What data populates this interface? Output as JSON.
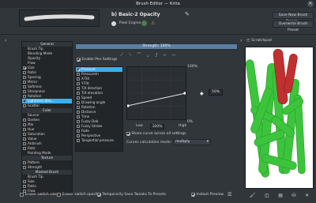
{
  "window": {
    "title": "Brush Editor — Krita"
  },
  "header": {
    "preset_name": "b) Basic-2 Opacity",
    "engine_label": "Pixel Engine",
    "save_new_label": "Save New Brush Preset...",
    "overwrite_label": "Overwrite Brush Preset"
  },
  "sidebar": {
    "items": [
      {
        "label": "General",
        "type": "header"
      },
      {
        "label": "Brush Tip",
        "checkbox": false
      },
      {
        "label": "Blending Mode",
        "checkbox": false
      },
      {
        "label": "Opacity",
        "checkbox": false
      },
      {
        "label": "Flow",
        "checkbox": false
      },
      {
        "label": "Size",
        "checkbox": true,
        "checked": true
      },
      {
        "label": "Ratio",
        "checkbox": true,
        "checked": false
      },
      {
        "label": "Spacing",
        "checkbox": true,
        "checked": false
      },
      {
        "label": "Mirror",
        "checkbox": true,
        "checked": false
      },
      {
        "label": "Softness",
        "checkbox": true,
        "checked": false
      },
      {
        "label": "Sharpness",
        "checkbox": true,
        "checked": false
      },
      {
        "label": "Rotation",
        "checkbox": true,
        "checked": false
      },
      {
        "label": "Lightness Stre...",
        "checkbox": true,
        "checked": false,
        "selected": true
      },
      {
        "label": "Scatter",
        "checkbox": true,
        "checked": false
      },
      {
        "label": "Color",
        "type": "header"
      },
      {
        "label": "Source",
        "checkbox": false
      },
      {
        "label": "Darken",
        "checkbox": true,
        "checked": false
      },
      {
        "label": "Mix",
        "checkbox": true,
        "checked": false
      },
      {
        "label": "Hue",
        "checkbox": true,
        "checked": false
      },
      {
        "label": "Saturation",
        "checkbox": true,
        "checked": false
      },
      {
        "label": "Value",
        "checkbox": true,
        "checked": false
      },
      {
        "label": "Airbrush",
        "checkbox": true,
        "checked": false
      },
      {
        "label": "Rate",
        "checkbox": true,
        "checked": false
      },
      {
        "label": "Painting Mode",
        "checkbox": false
      },
      {
        "label": "Texture",
        "type": "header"
      },
      {
        "label": "Pattern",
        "checkbox": true,
        "checked": false
      },
      {
        "label": "Strength",
        "checkbox": true,
        "checked": false
      },
      {
        "label": "Masked Brush",
        "type": "header"
      },
      {
        "label": "Brush Tip",
        "checkbox": false
      },
      {
        "label": "Size",
        "checkbox": true,
        "checked": false
      },
      {
        "label": "Ratio",
        "checkbox": true,
        "checked": false
      },
      {
        "label": "Flow",
        "checkbox": true,
        "checked": false
      }
    ]
  },
  "settings": {
    "strength_label": "Strength: 100%",
    "enable_pen_label": "Enable Pen Settings",
    "sensors": [
      {
        "label": "Pressure",
        "checked": true,
        "selected": true
      },
      {
        "label": "PressureIn",
        "checked": false
      },
      {
        "label": "X-Tilt",
        "checked": false
      },
      {
        "label": "Y-Tilt",
        "checked": false
      },
      {
        "label": "Tilt direction",
        "checked": false
      },
      {
        "label": "Tilt elevation",
        "checked": false
      },
      {
        "label": "Speed",
        "checked": false
      },
      {
        "label": "Drawing angle",
        "checked": false
      },
      {
        "label": "Rotation",
        "checked": false
      },
      {
        "label": "Distance",
        "checked": false
      },
      {
        "label": "Time",
        "checked": false
      },
      {
        "label": "Fuzzy Dab",
        "checked": false
      },
      {
        "label": "Fuzzy Stroke",
        "checked": false
      },
      {
        "label": "Fade",
        "checked": false
      },
      {
        "label": "Perspective",
        "checked": false
      },
      {
        "label": "Tangential pressure",
        "checked": false
      }
    ],
    "curve_top": "100%",
    "curve_bottom": "0%",
    "curve_value": "50%",
    "low_label": "Low",
    "low_value": "100%",
    "high_label": "High",
    "share_curve_label": "Share curve across all settings",
    "calc_mode_label": "Curves calculation mode:",
    "calc_mode_value": "multiply"
  },
  "scratchpad": {
    "label": "Scratchpad"
  },
  "footer": {
    "eraser_size_label": "Eraser switch size",
    "eraser_opacity_label": "Eraser switch opacity",
    "temp_save_label": "Temporarily Save Tweaks To Presets",
    "instant_preview_label": "Instant Preview"
  },
  "colors": {
    "accent": "#3daee9",
    "background": "#31363b",
    "panel": "#232629",
    "stroke_green": "#3cc43c",
    "stroke_red": "#c03030"
  }
}
